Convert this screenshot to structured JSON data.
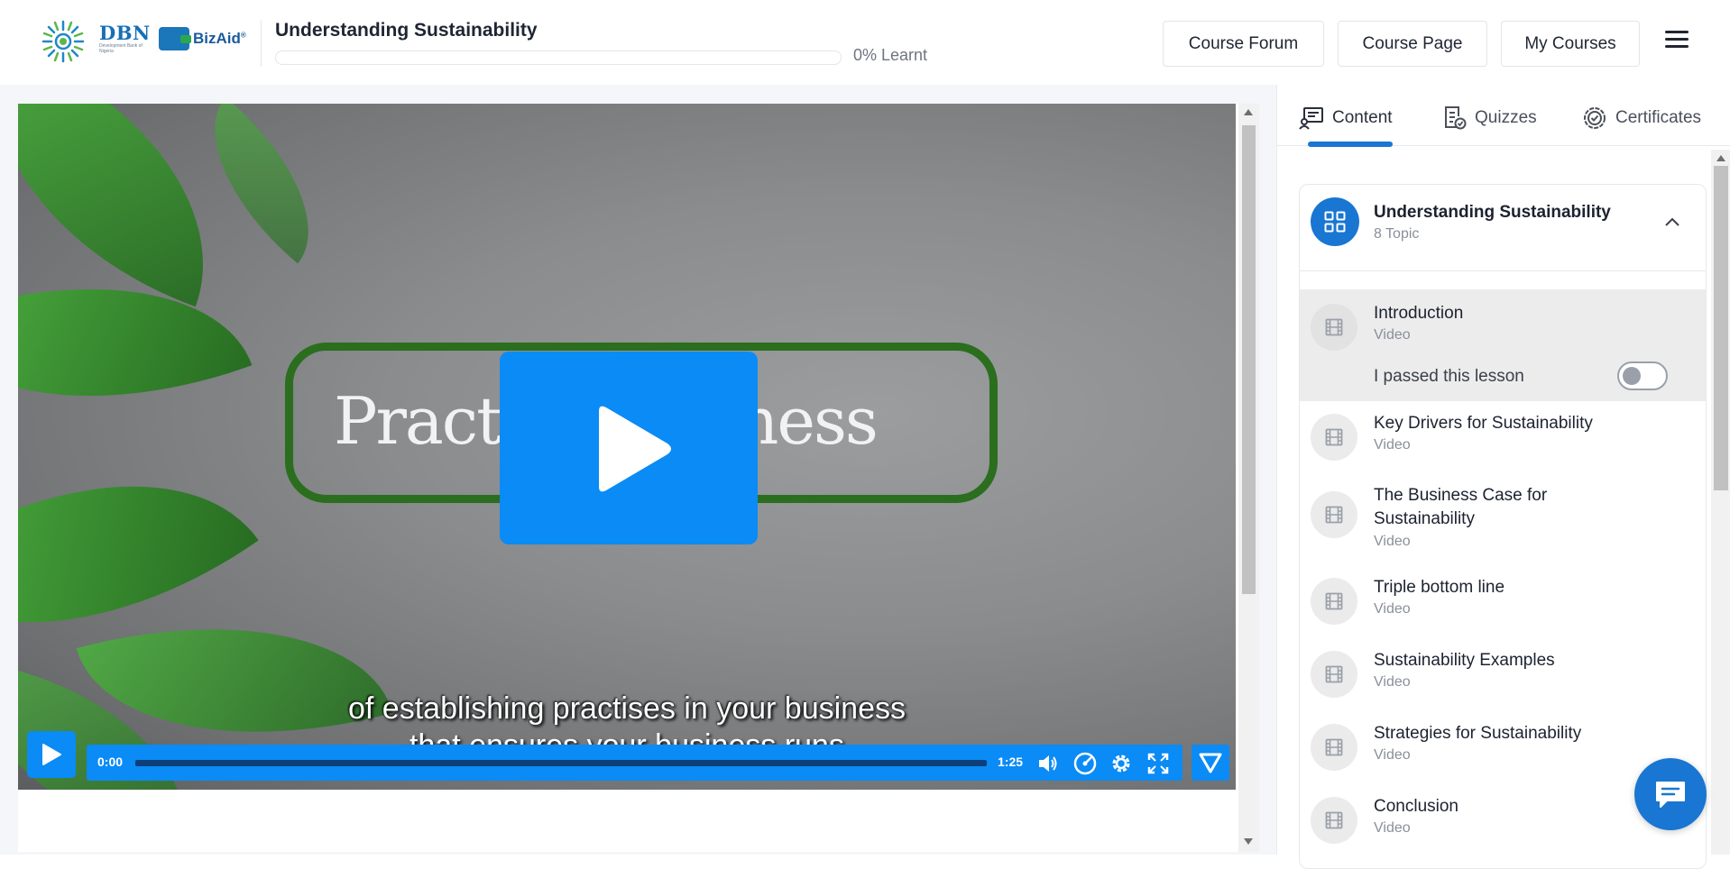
{
  "header": {
    "logo_primary": "DBN",
    "logo_primary_sub": "Development Bank of Nigeria",
    "logo_secondary": "BizAid",
    "course_title": "Understanding Sustainability",
    "progress_percent": 0,
    "progress_text": "0% Learnt",
    "buttons": {
      "forum": "Course Forum",
      "page": "Course Page",
      "courses": "My Courses"
    },
    "menu_icon": "hamburger-menu-icon"
  },
  "player": {
    "frame_text": "Practise        business",
    "subtitle_line1": "of establishing practises in your business",
    "subtitle_line2": "that ensures your business runs",
    "time_current": "0:00",
    "time_duration": "1:25",
    "accent_color": "#0a8bf5",
    "controls": [
      "play-icon",
      "volume-icon",
      "speed-icon",
      "settings-gear-icon",
      "fullscreen-icon",
      "vimeo-logo-icon"
    ]
  },
  "sidebar": {
    "tabs": [
      {
        "label": "Content",
        "icon": "content-icon",
        "active": true
      },
      {
        "label": "Quizzes",
        "icon": "quiz-icon",
        "active": false
      },
      {
        "label": "Certificates",
        "icon": "certificate-icon",
        "active": false
      }
    ],
    "module": {
      "title": "Understanding Sustainability",
      "count": "8 Topic",
      "icon": "grid-icon",
      "expanded": true
    },
    "passed_label": "I passed this lesson",
    "lessons": [
      {
        "title": "Introduction",
        "type": "Video"
      },
      {
        "title": "Key Drivers for Sustainability",
        "type": "Video"
      },
      {
        "title": "The Business Case for Sustainability",
        "type": "Video"
      },
      {
        "title": "Triple bottom line",
        "type": "Video"
      },
      {
        "title": "Sustainability Examples",
        "type": "Video"
      },
      {
        "title": "Strategies for Sustainability",
        "type": "Video"
      },
      {
        "title": "Conclusion",
        "type": "Video"
      }
    ]
  },
  "chat_icon": "chat-bubble-icon"
}
